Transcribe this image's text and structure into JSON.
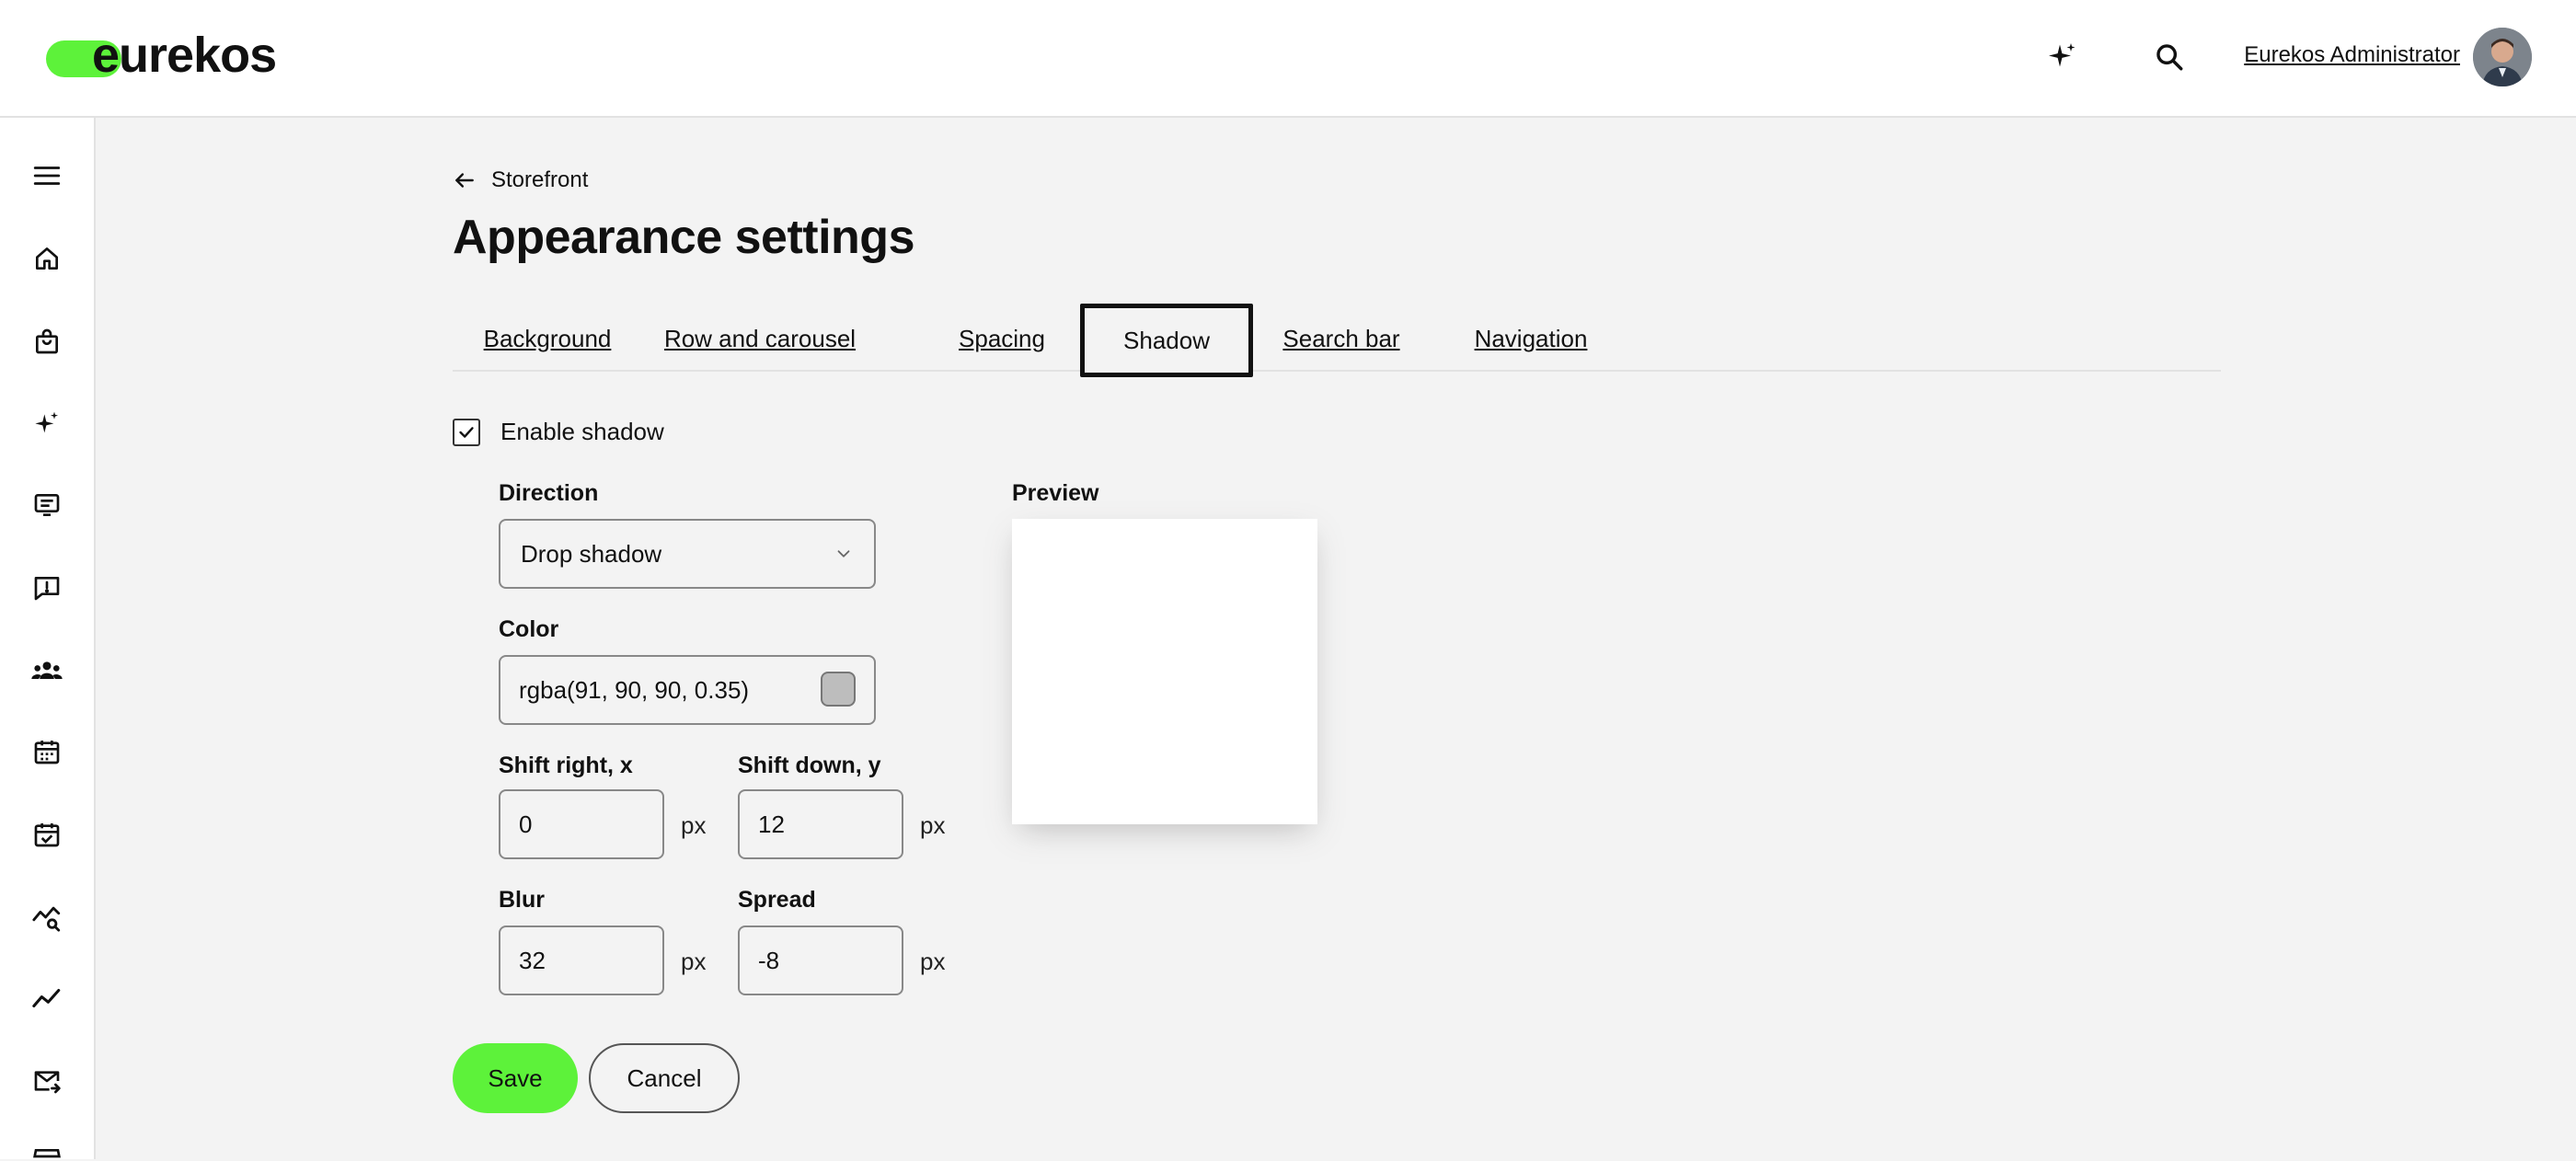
{
  "header": {
    "logo_text": "eurekos",
    "user_name": "Eurekos Administrator",
    "brand_color": "#5df23a",
    "icons": [
      "sparkle-icon",
      "search-icon"
    ]
  },
  "sidebar": {
    "icons": [
      "menu-icon",
      "home-icon",
      "shopping-bag-icon",
      "sparkle-icon",
      "monitor-list-icon",
      "feedback-icon",
      "people-icon",
      "calendar-icon",
      "calendar-check-icon",
      "analytics-search-icon",
      "trend-line-icon",
      "mail-forward-icon",
      "store-icon"
    ]
  },
  "breadcrumb": {
    "back_label": "Storefront"
  },
  "page": {
    "title": "Appearance settings"
  },
  "tabs": [
    {
      "label": "Background"
    },
    {
      "label": "Row and carousel"
    },
    {
      "label": "Spacing"
    },
    {
      "label": "Shadow",
      "active": true
    },
    {
      "label": "Search bar"
    },
    {
      "label": "Navigation"
    }
  ],
  "shadow": {
    "enable_label": "Enable shadow",
    "enabled": true,
    "direction": {
      "label": "Direction",
      "value": "Drop shadow"
    },
    "color": {
      "label": "Color",
      "value": "rgba(91, 90, 90, 0.35)"
    },
    "shift_x": {
      "label": "Shift right, x",
      "value": "0",
      "unit": "px"
    },
    "shift_y": {
      "label": "Shift down, y",
      "value": "12",
      "unit": "px"
    },
    "blur": {
      "label": "Blur",
      "value": "32",
      "unit": "px"
    },
    "spread": {
      "label": "Spread",
      "value": "-8",
      "unit": "px"
    },
    "preview_label": "Preview"
  },
  "actions": {
    "save_label": "Save",
    "cancel_label": "Cancel"
  }
}
